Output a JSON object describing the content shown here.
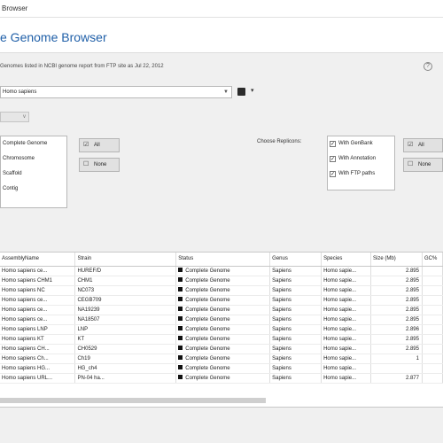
{
  "window": {
    "title": "Browser"
  },
  "header": {
    "title": "e Genome Browser"
  },
  "info": {
    "text": "Genomes listed in NCBI genome report from FTP site as Jul 22, 2012"
  },
  "dropdown": {
    "value": "Homo sapiens"
  },
  "small_dropdown": {
    "value": "v"
  },
  "left_list": {
    "items": [
      "Complete Genome",
      "Chromosome",
      "Scaffold",
      "Contig"
    ]
  },
  "left_buttons": {
    "all_label": "All",
    "none_label": "None"
  },
  "right_list": {
    "label": "Choose Replicons:",
    "items": [
      {
        "label": "With GenBank",
        "checked": true
      },
      {
        "label": "With Annotation",
        "checked": true
      },
      {
        "label": "With FTP paths",
        "checked": true
      }
    ]
  },
  "right_buttons": {
    "all_label": "All",
    "none_label": "None"
  },
  "table": {
    "headers": [
      "AssemblyName",
      "Strain",
      "Status",
      "Genus",
      "Species",
      "Size (Mb)",
      "GC%"
    ],
    "rows": [
      [
        "Homo sapiens ce...",
        "HUREF/D",
        "Complete Genome",
        "Sapiens",
        "Homo sapie...",
        "2.895",
        ""
      ],
      [
        "Homo sapiens CHM1",
        "CHM1",
        "Complete Genome",
        "Sapiens",
        "Homo sapie...",
        "2.895",
        ""
      ],
      [
        "Homo sapiens NC",
        "NC073",
        "Complete Genome",
        "Sapiens",
        "Homo sapie...",
        "2.895",
        ""
      ],
      [
        "Homo sapiens ce...",
        "CEGB709",
        "Complete Genome",
        "Sapiens",
        "Homo sapie...",
        "2.895",
        ""
      ],
      [
        "Homo sapiens ce...",
        "NA19239",
        "Complete Genome",
        "Sapiens",
        "Homo sapie...",
        "2.895",
        ""
      ],
      [
        "Homo sapiens ce...",
        "NA18507",
        "Complete Genome",
        "Sapiens",
        "Homo sapie...",
        "2.895",
        ""
      ],
      [
        "Homo sapiens LNP",
        "LNP",
        "Complete Genome",
        "Sapiens",
        "Homo sapie...",
        "2.896",
        ""
      ],
      [
        "Homo sapiens KT",
        "KT",
        "Complete Genome",
        "Sapiens",
        "Homo sapie...",
        "2.895",
        ""
      ],
      [
        "Homo sapiens CH...",
        "CH0529",
        "Complete Genome",
        "Sapiens",
        "Homo sapie...",
        "2.895",
        ""
      ],
      [
        "Homo sapiens Ch...",
        "Ch19",
        "Complete Genome",
        "Sapiens",
        "Homo sapie...",
        "1",
        ""
      ],
      [
        "Homo sapiens HG...",
        "HG_ch4",
        "Complete Genome",
        "Sapiens",
        "Homo sapie...",
        "",
        ""
      ],
      [
        "Homo sapiens URL...",
        "PN-04 ha...",
        "Complete Genome",
        "Sapiens",
        "Homo sapie...",
        "2.877",
        ""
      ]
    ]
  }
}
